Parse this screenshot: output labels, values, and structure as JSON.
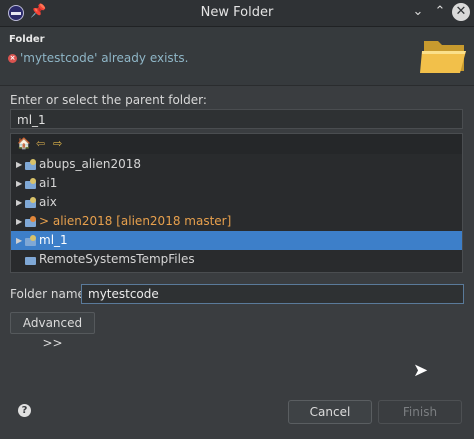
{
  "window": {
    "title": "New Folder",
    "app_icon": "eclipse-icon",
    "pin_icon": "pin-icon",
    "minimize_icon": "chevron-down-icon",
    "maximize_icon": "chevron-up-icon",
    "close_icon": "close-icon"
  },
  "header": {
    "title": "Folder",
    "error_message": "'mytestcode' already exists.",
    "error_icon": "error-icon",
    "banner_icon": "folder-open-icon",
    "error_color": "#d9534f",
    "message_color": "#8fb6c7"
  },
  "parent": {
    "label": "Enter or select the parent folder:",
    "value": "ml_1"
  },
  "tree": {
    "toolbar": {
      "home_icon": "home-icon",
      "back_icon": "back-arrow-icon",
      "forward_icon": "forward-arrow-icon"
    },
    "items": [
      {
        "label": "abups_alien2018",
        "expandable": true,
        "selected": false,
        "git": false
      },
      {
        "label": "ai1",
        "expandable": true,
        "selected": false,
        "git": false
      },
      {
        "label": "aix",
        "expandable": true,
        "selected": false,
        "git": false
      },
      {
        "label": "> alien2018 [alien2018 master]",
        "expandable": true,
        "selected": false,
        "git": true
      },
      {
        "label": "ml_1",
        "expandable": true,
        "selected": true,
        "git": false
      },
      {
        "label": "RemoteSystemsTempFiles",
        "expandable": false,
        "selected": false,
        "git": false
      }
    ],
    "selection_color": "#3d7fc9",
    "git_label_color": "#e7a04d"
  },
  "folder_name": {
    "label": "Folder name:",
    "value": "mytestcode"
  },
  "buttons": {
    "advanced": "Advanced >>",
    "cancel": "Cancel",
    "finish": "Finish",
    "help_icon": "help-icon"
  }
}
